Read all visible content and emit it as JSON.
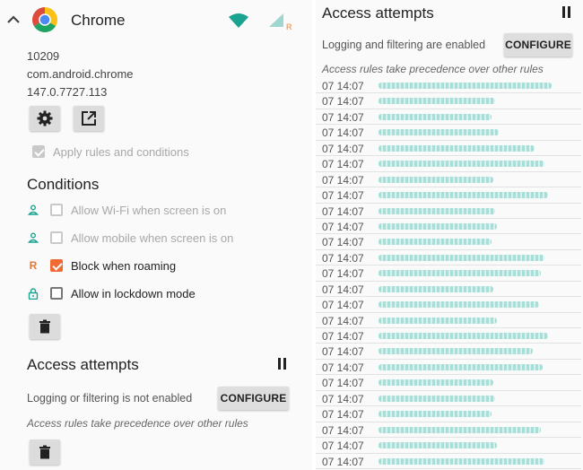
{
  "app": {
    "name": "Chrome",
    "uid": "10209",
    "package": "com.android.chrome",
    "version": "147.0.7727.113",
    "roaming_badge": "R"
  },
  "apply_rules": {
    "label": "Apply rules and conditions",
    "checked": true,
    "enabled": false
  },
  "conditions": {
    "title": "Conditions",
    "items": [
      {
        "label": "Allow Wi-Fi when screen is on",
        "icon": "person-icon",
        "checked": false,
        "enabled": false
      },
      {
        "label": "Allow mobile when screen is on",
        "icon": "person-icon",
        "checked": false,
        "enabled": false
      },
      {
        "label": "Block when roaming",
        "icon": "R",
        "checked": true,
        "enabled": true
      },
      {
        "label": "Allow in lockdown mode",
        "icon": "lock-icon",
        "checked": false,
        "enabled": true
      }
    ]
  },
  "left_access": {
    "title": "Access attempts",
    "status": "Logging or filtering is not enabled",
    "configure_label": "CONFIGURE",
    "note": "Access rules take precedence over other rules"
  },
  "right_access": {
    "title": "Access attempts",
    "status": "Logging and filtering are enabled",
    "configure_label": "CONFIGURE",
    "note": "Access rules take precedence over other rules",
    "entries": [
      {
        "time": "07 14:07",
        "bar": 0.92
      },
      {
        "time": "07 14:07",
        "bar": 0.62
      },
      {
        "time": "07 14:07",
        "bar": 0.6
      },
      {
        "time": "07 14:07",
        "bar": 0.64
      },
      {
        "time": "07 14:07",
        "bar": 0.83
      },
      {
        "time": "07 14:07",
        "bar": 0.88
      },
      {
        "time": "07 14:07",
        "bar": 0.61
      },
      {
        "time": "07 14:07",
        "bar": 0.9
      },
      {
        "time": "07 14:07",
        "bar": 0.62
      },
      {
        "time": "07 14:07",
        "bar": 0.63
      },
      {
        "time": "07 14:07",
        "bar": 0.6
      },
      {
        "time": "07 14:07",
        "bar": 0.88
      },
      {
        "time": "07 14:07",
        "bar": 0.86
      },
      {
        "time": "07 14:07",
        "bar": 0.61
      },
      {
        "time": "07 14:07",
        "bar": 0.85
      },
      {
        "time": "07 14:07",
        "bar": 0.63
      },
      {
        "time": "07 14:07",
        "bar": 0.9
      },
      {
        "time": "07 14:07",
        "bar": 0.82
      },
      {
        "time": "07 14:07",
        "bar": 0.87
      },
      {
        "time": "07 14:07",
        "bar": 0.61
      },
      {
        "time": "07 14:07",
        "bar": 0.62
      },
      {
        "time": "07 14:07",
        "bar": 0.6
      },
      {
        "time": "07 14:07",
        "bar": 0.86
      },
      {
        "time": "07 14:07",
        "bar": 0.63
      },
      {
        "time": "07 14:07",
        "bar": 0.88
      }
    ]
  },
  "colors": {
    "accent": "#f06a31",
    "teal": "#1aa390",
    "log_bar": "#a6ded8"
  }
}
